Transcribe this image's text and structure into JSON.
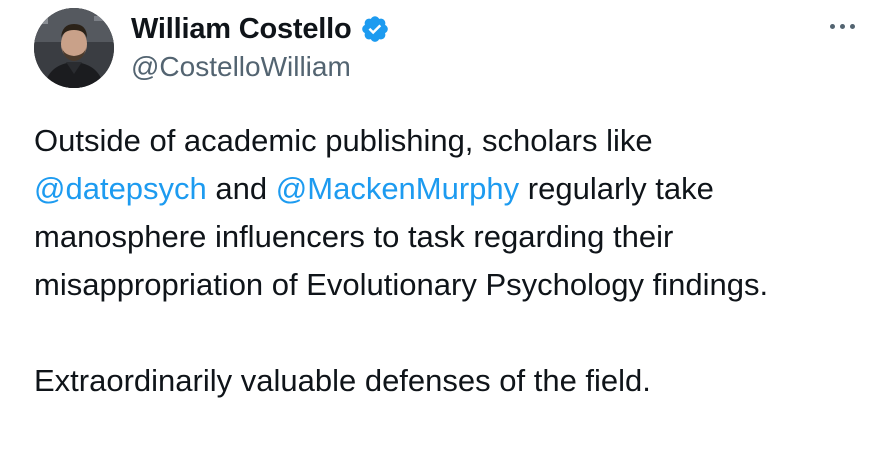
{
  "author": {
    "display_name": "William Costello",
    "handle": "@CostelloWilliam",
    "verified": true,
    "avatar_icon": "profile-photo"
  },
  "menu": {
    "icon": "more-horizontal-icon"
  },
  "tweet": {
    "paragraph_1": {
      "part_1": "Outside of academic publishing, scholars like",
      "mention_1": "@datepsych",
      "part_2": "and",
      "mention_2": "@MackenMurphy",
      "part_3": "regularly take manosphere influencers to task regarding their misappropriation of Evolutionary Psychology findings."
    },
    "paragraph_2": "Extraordinarily valuable defenses of the field."
  },
  "colors": {
    "text": "#0f1419",
    "secondary": "#536471",
    "link": "#1d9bf0",
    "verified_badge": "#1d9bf0"
  }
}
